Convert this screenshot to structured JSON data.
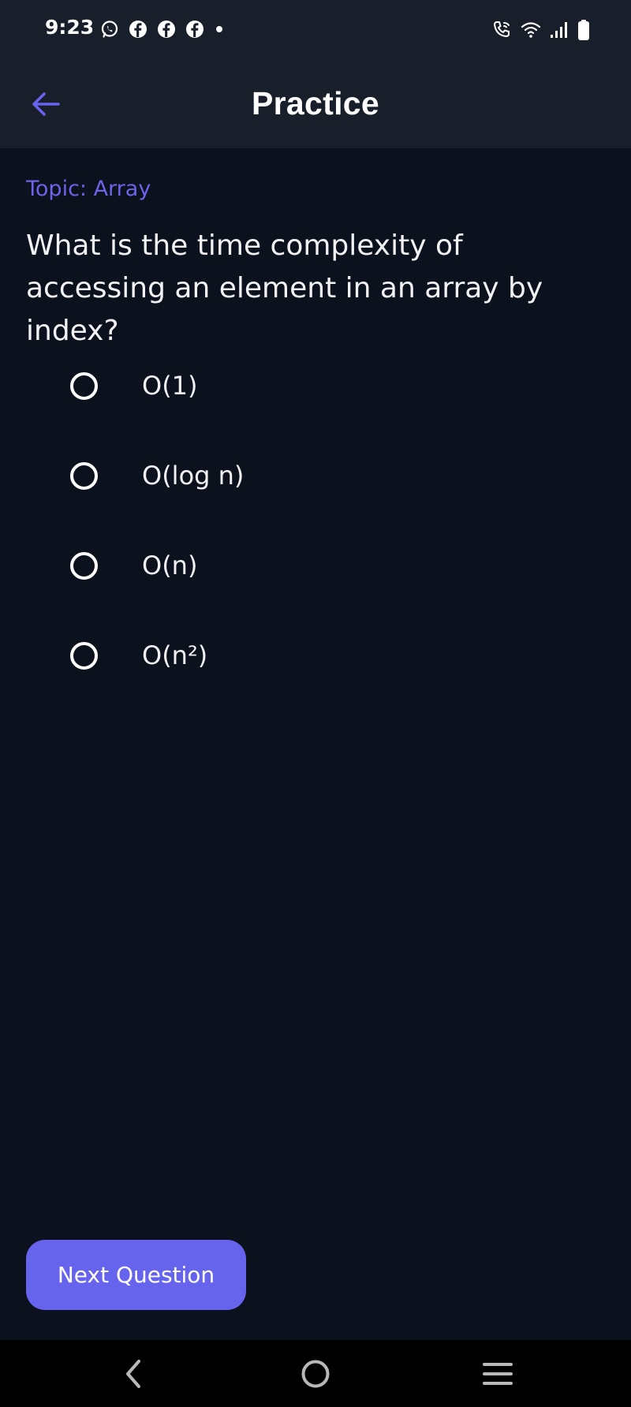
{
  "status_bar": {
    "time": "9:23",
    "notification_icons": [
      "whatsapp-icon",
      "facebook-icon",
      "facebook-icon",
      "facebook-icon",
      "dot-icon"
    ],
    "system_icons": [
      "wifi-call-icon",
      "wifi-icon",
      "signal-icon",
      "battery-icon"
    ]
  },
  "app_bar": {
    "title": "Practice",
    "back_icon": "arrow-left-icon"
  },
  "quiz": {
    "topic": "Topic: Array",
    "question": "What is the time complexity of accessing an element in an array by index?",
    "options": [
      {
        "label": "O(1)",
        "selected": false
      },
      {
        "label": "O(log n)",
        "selected": false
      },
      {
        "label": "O(n)",
        "selected": false
      },
      {
        "label": "O(n²)",
        "selected": false
      }
    ],
    "next_label": "Next Question"
  },
  "nav_bar": {
    "icons": [
      "nav-back-icon",
      "nav-home-icon",
      "nav-menu-icon"
    ]
  },
  "colors": {
    "background": "#0c111e",
    "app_bar": "#181e2a",
    "accent": "#6663ec",
    "topic_text": "#6c63e8",
    "text": "#f2f2f4"
  }
}
